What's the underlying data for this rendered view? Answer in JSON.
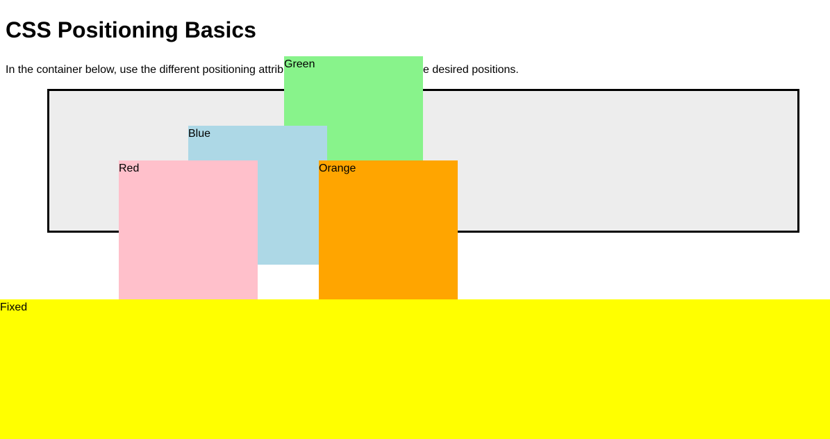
{
  "page": {
    "title": "CSS Positioning Basics",
    "instructions": "In the container below, use the different positioning attributes to move the boxes to the desired positions."
  },
  "boxes": {
    "green": {
      "label": "Green",
      "color": "#88f38b"
    },
    "blue": {
      "label": "Blue",
      "color": "#add8e6"
    },
    "orange": {
      "label": "Orange",
      "color": "#ffa500"
    },
    "red": {
      "label": "Red",
      "color": "#ffc0cb"
    },
    "fixed": {
      "label": "Fixed",
      "color": "#ffff00"
    }
  },
  "container": {
    "background": "#ededed",
    "border_color": "#000000"
  }
}
